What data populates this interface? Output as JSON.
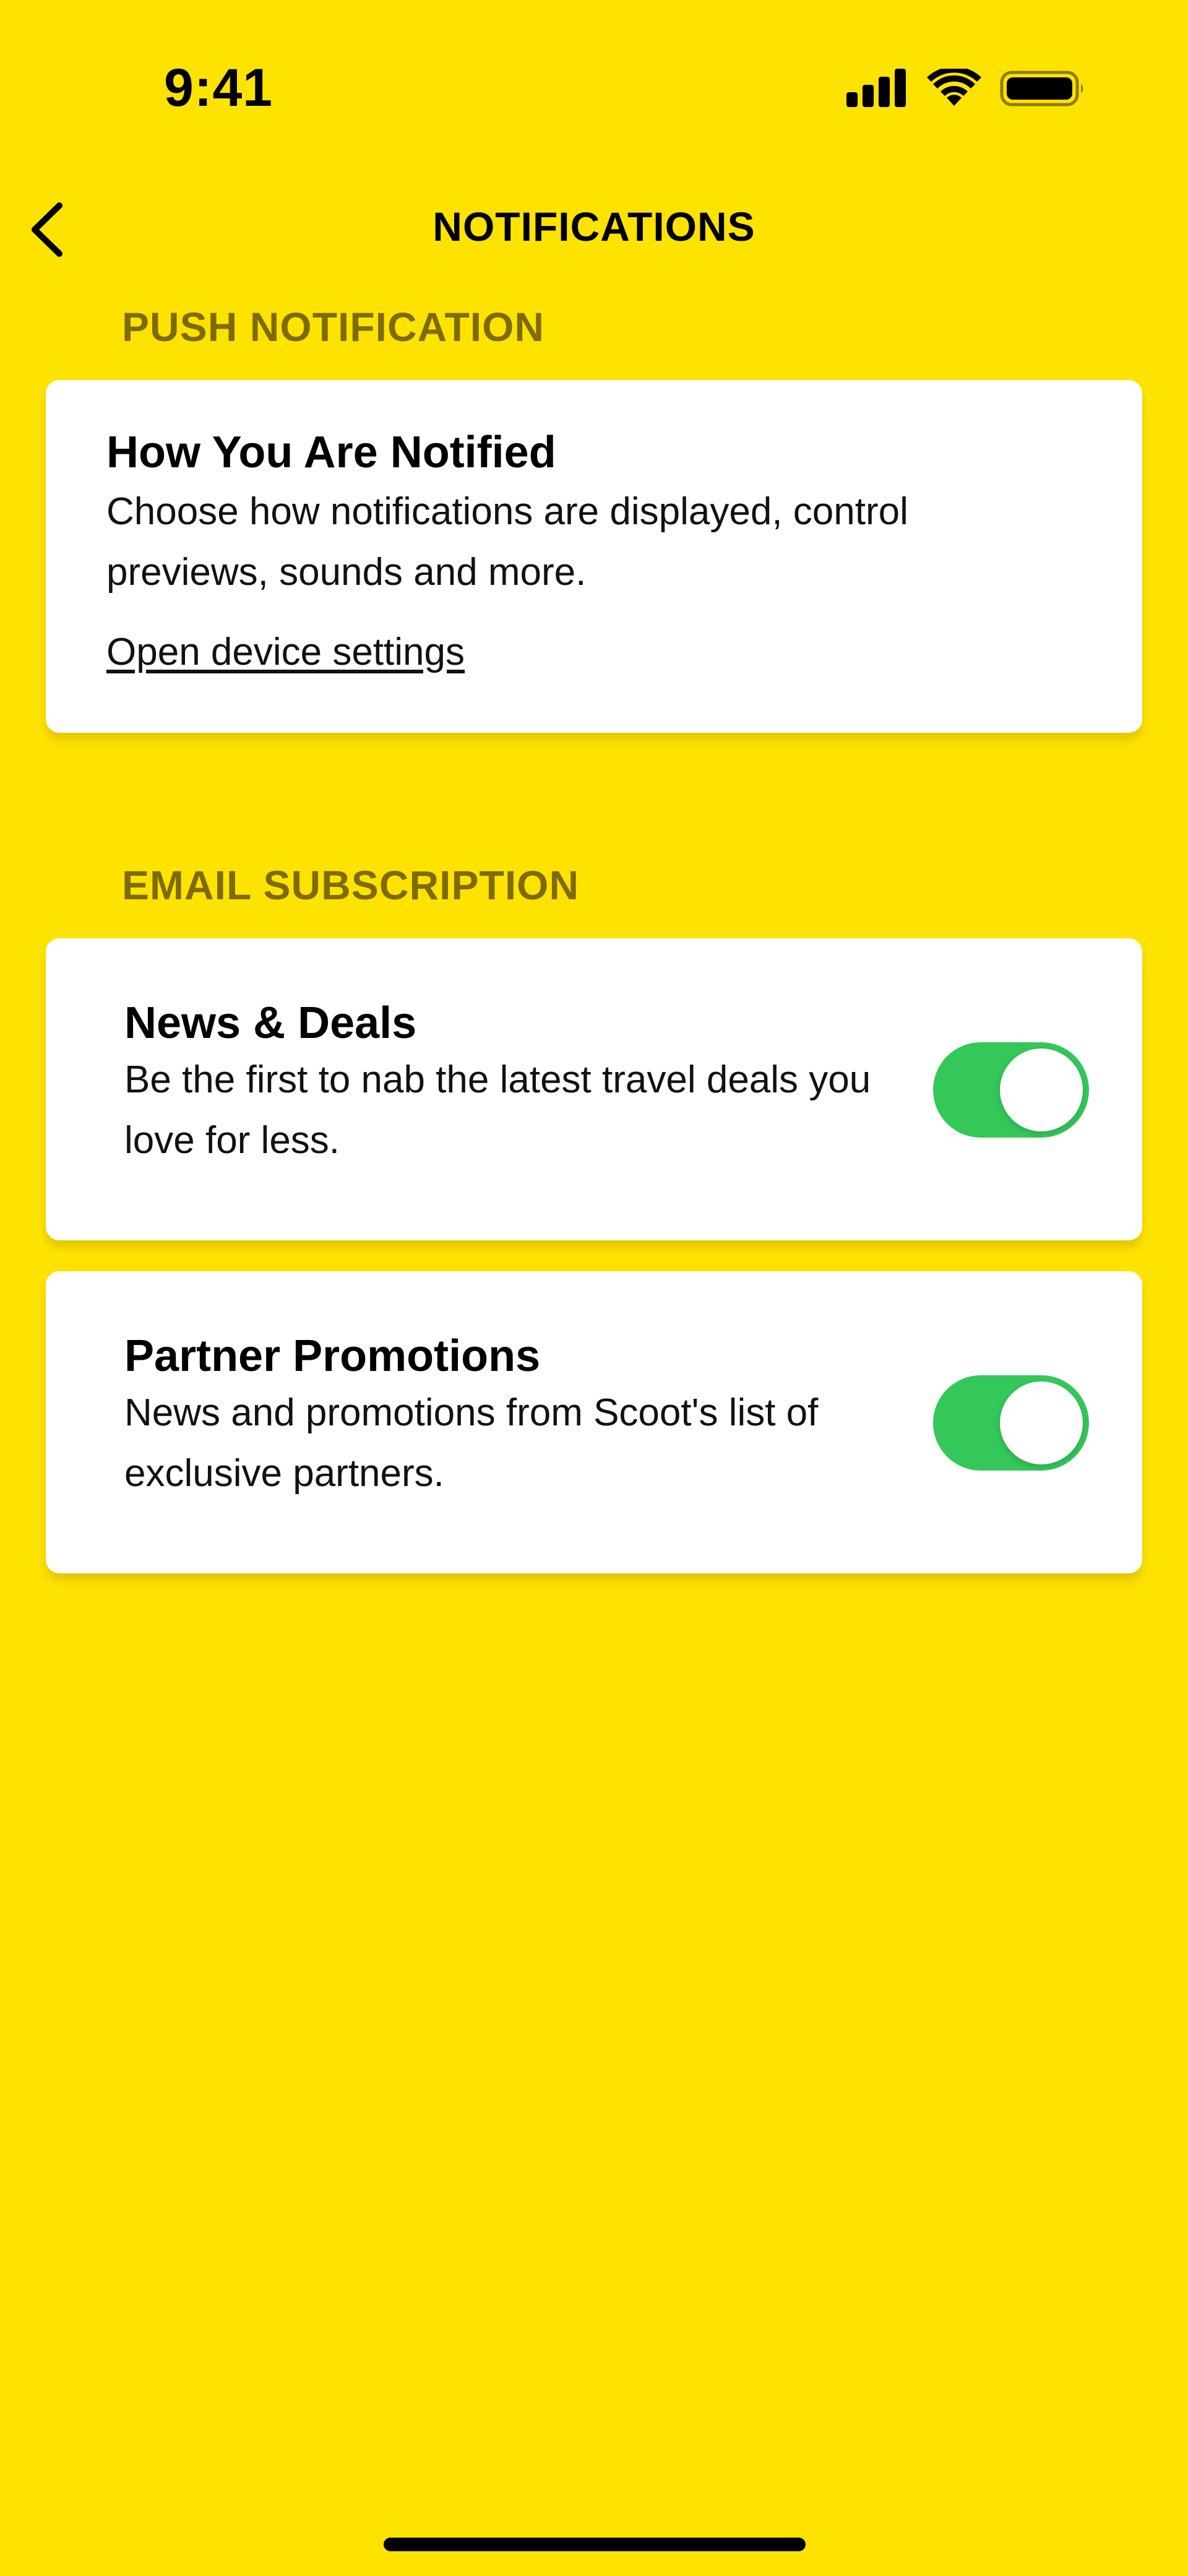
{
  "status_bar": {
    "time": "9:41",
    "icons": [
      "signal-icon",
      "wifi-icon",
      "battery-icon"
    ]
  },
  "nav": {
    "title": "NOTIFICATIONS",
    "back_icon": "chevron-left-icon"
  },
  "push_section": {
    "header": "PUSH NOTIFICATION",
    "card": {
      "title": "How You Are Notified",
      "description": "Choose how notifications are displayed, control previews, sounds and more.",
      "link": "Open device settings"
    }
  },
  "email_section": {
    "header": "EMAIL SUBSCRIPTION",
    "items": [
      {
        "title": "News & Deals",
        "description": "Be the first to nab the latest travel deals you love for less.",
        "enabled": true
      },
      {
        "title": "Partner Promotions",
        "description": "News and promotions from Scoot's list of exclusive partners.",
        "enabled": true
      }
    ]
  },
  "colors": {
    "background": "#FFE300",
    "section_header": "#7E6B00",
    "card": "#FFFFFF",
    "toggle_on": "#34C759"
  }
}
